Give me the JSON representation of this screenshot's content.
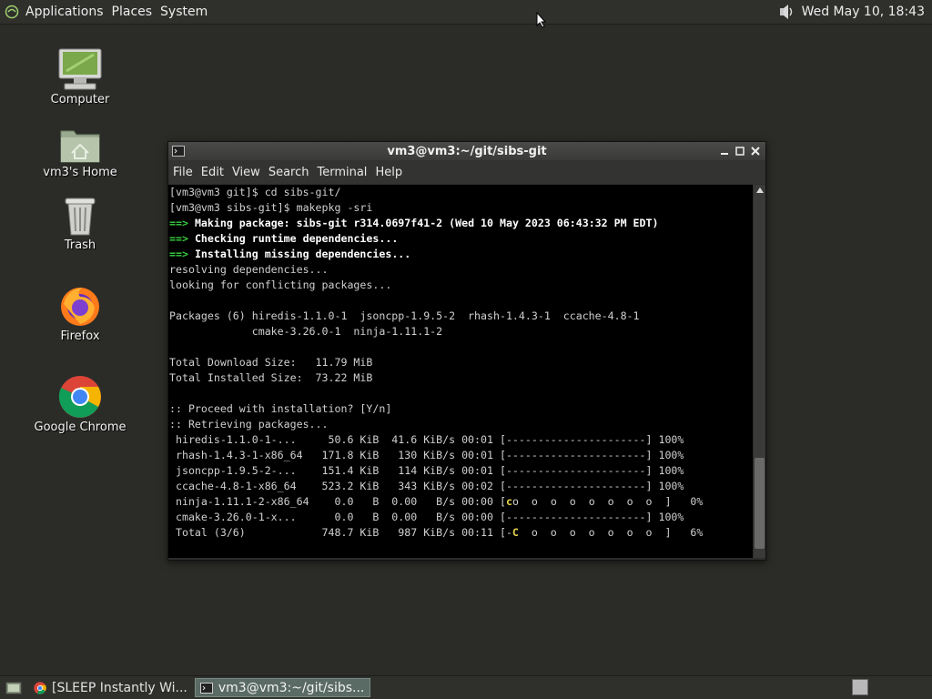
{
  "top_panel": {
    "menus": [
      "Applications",
      "Places",
      "System"
    ],
    "clock": "Wed May 10, 18:43",
    "icons": {
      "logo": "distro-logo-icon",
      "speaker": "speaker-volume-icon"
    }
  },
  "desktop": {
    "icons": [
      {
        "label": "Computer",
        "icon": "computer-icon"
      },
      {
        "label": "vm3's Home",
        "icon": "home-folder-icon"
      },
      {
        "label": "Trash",
        "icon": "trash-icon"
      },
      {
        "label": "Firefox",
        "icon": "firefox-icon"
      },
      {
        "label": "Google Chrome",
        "icon": "chrome-icon"
      }
    ]
  },
  "window": {
    "title": "vm3@vm3:~/git/sibs-git",
    "menu": [
      "File",
      "Edit",
      "View",
      "Search",
      "Terminal",
      "Help"
    ]
  },
  "terminal": {
    "lines": [
      "[vm3@vm3 git]$ cd sibs-git/",
      "[vm3@vm3 sibs-git]$ makepkg -sri",
      "Making package: sibs-git r314.0697f41-2 (Wed 10 May 2023 06:43:32 PM EDT)",
      "Checking runtime dependencies...",
      "Installing missing dependencies...",
      "resolving dependencies...",
      "looking for conflicting packages...",
      "",
      "Packages (6) hiredis-1.1.0-1  jsoncpp-1.9.5-2  rhash-1.4.3-1  ccache-4.8-1",
      "             cmake-3.26.0-1  ninja-1.11.1-2",
      "",
      "Total Download Size:   11.79 MiB",
      "Total Installed Size:  73.22 MiB",
      "",
      ":: Proceed with installation? [Y/n]",
      ":: Retrieving packages...",
      " hiredis-1.1.0-1-...     50.6 KiB  41.6 KiB/s 00:01 [----------------------] 100%",
      " rhash-1.4.3-1-x86_64   171.8 KiB   130 KiB/s 00:01 [----------------------] 100%",
      " jsoncpp-1.9.5-2-...    151.4 KiB   114 KiB/s 00:01 [----------------------] 100%",
      " ccache-4.8-1-x86_64    523.2 KiB   343 KiB/s 00:02 [----------------------] 100%",
      " ninja-1.11.1-2-x86_64    0.0   B  0.00   B/s 00:00 [",
      " cmake-3.26.0-1-x...      0.0   B  0.00   B/s 00:00 [----------------------] 100%",
      " Total (3/6)            748.7 KiB   987 KiB/s 00:11 [-"
    ],
    "arrow": "==>",
    "ninja_pac": "c",
    "ninja_tail": "o  o  o  o  o  o  o  o  ]   0%",
    "total_pac": "C",
    "total_tail": "  o  o  o  o  o  o  o  ]   6%"
  },
  "bottom_panel": {
    "tasks": [
      {
        "label": "[SLEEP Instantly Wi...",
        "icon": "chrome-icon",
        "active": false
      },
      {
        "label": "vm3@vm3:~/git/sibs...",
        "icon": "terminal-icon",
        "active": true
      }
    ]
  }
}
